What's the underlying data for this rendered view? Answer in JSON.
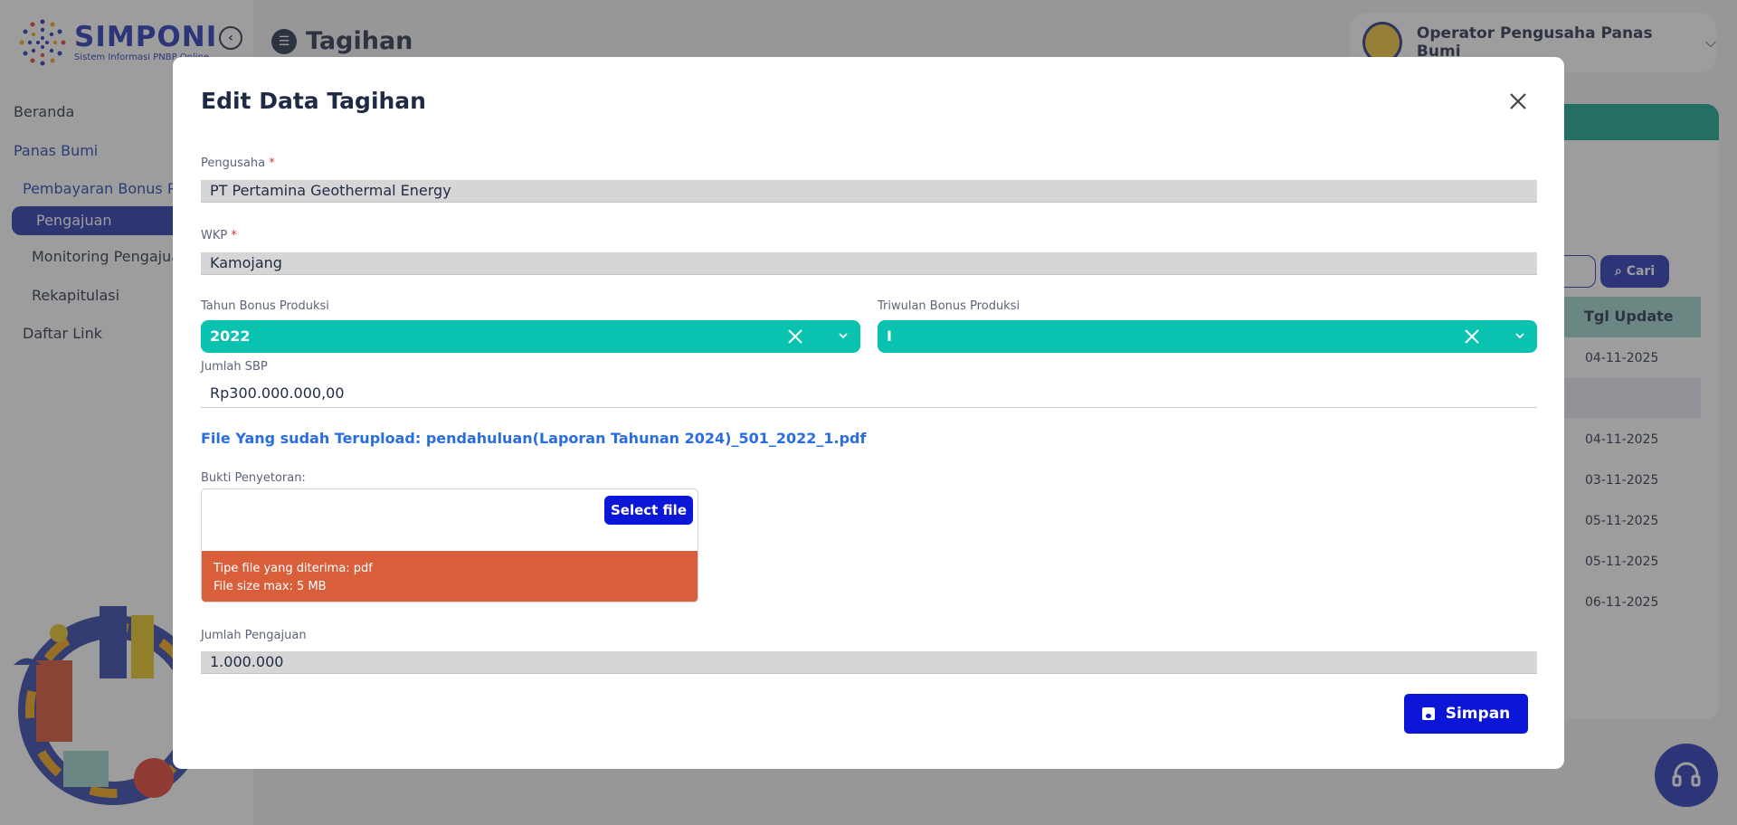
{
  "app": {
    "name": "SIMPONI",
    "subtitle": "Sistem Informasi PNBP Online"
  },
  "sidebar": {
    "items": [
      {
        "label": "Beranda"
      },
      {
        "label": "Panas Bumi"
      },
      {
        "label": "Pembayaran Bonus Produksi"
      },
      {
        "label": "Pengajuan"
      },
      {
        "label": "Monitoring Pengajuan"
      },
      {
        "label": "Rekapitulasi"
      },
      {
        "label": "Daftar Link"
      }
    ]
  },
  "header": {
    "page_title": "Tagihan",
    "user_name": "Operator Pengusaha Panas Bumi"
  },
  "background_table": {
    "search_label": "Cari",
    "column_header": "Tgl Update",
    "dates": [
      "04-11-2025",
      "04-11-2025",
      "03-11-2025",
      "05-11-2025",
      "05-11-2025",
      "06-11-2025"
    ]
  },
  "modal": {
    "title": "Edit Data Tagihan",
    "pengusaha": {
      "label": "Pengusaha",
      "required": "*",
      "value": "PT Pertamina Geothermal Energy"
    },
    "wkp": {
      "label": "WKP",
      "required": "*",
      "value": "Kamojang"
    },
    "tahun": {
      "label": "Tahun Bonus Produksi",
      "value": "2022"
    },
    "triwulan": {
      "label": "Triwulan Bonus Produksi",
      "value": "I"
    },
    "jumlah_sbp": {
      "label": "Jumlah SBP",
      "value": "Rp300.000.000,00"
    },
    "uploaded_file": "File Yang sudah Terupload: pendahuluan(Laporan Tahunan 2024)_501_2022_1.pdf",
    "bukti": {
      "label": "Bukti Penyetoran:",
      "select_file_label": "Select file",
      "info_type": "Tipe file yang diterima: pdf",
      "info_size": "File size max: 5 MB"
    },
    "jumlah_pengajuan": {
      "label": "Jumlah Pengajuan",
      "value": "1.000.000"
    },
    "save_label": "Simpan"
  }
}
